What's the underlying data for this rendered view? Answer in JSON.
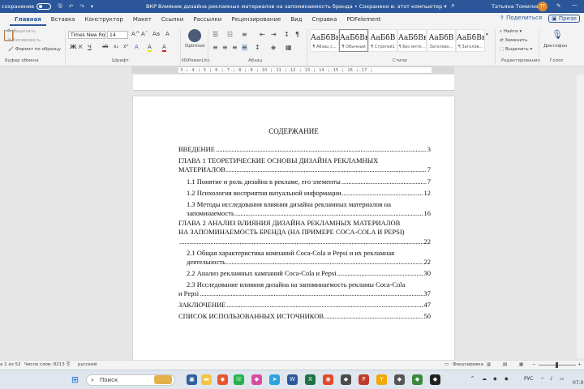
{
  "titlebar": {
    "autosave_label": "сохранение",
    "undo_icon": "undo-icon",
    "redo_icon": "redo-icon",
    "document_title": "ВКР Влияние дизайна рекламных материалов на запоминаемость бренда  •  Сохранено в: этот компьютер  ▾",
    "user_name": "Татьяна Томилова",
    "avatar_initials": "ТТ",
    "minimize_glyph": "—"
  },
  "tabs": [
    "Главная",
    "Вставка",
    "Конструктор",
    "Макет",
    "Ссылки",
    "Рассылки",
    "Рецензирование",
    "Вид",
    "Справка",
    "PDFelement"
  ],
  "active_tab": "Главная",
  "share_label": "Поделиться",
  "present_label": "Презе",
  "ribbon": {
    "clipboard": {
      "cut": "Вырезать",
      "copy": "Копировать",
      "format_painter": "Формат по образцу",
      "label": "Буфер обмена"
    },
    "font": {
      "name": "Times New Roi",
      "size": "14",
      "label": "Шрифт",
      "bold": "Ж",
      "italic": "К",
      "underline": "Ч",
      "strike": "ab",
      "sub": "x₂",
      "sup": "x²",
      "grow": "A^",
      "shrink": "Aˇ",
      "case": "Aa",
      "clear": "A",
      "highlight": "A",
      "color": "A"
    },
    "nxpower": {
      "button": "Optimize",
      "label": "NXPowerLite"
    },
    "paragraph": {
      "label": "Абзац"
    },
    "styles": {
      "label": "Стили",
      "tiles": [
        {
          "sample": "АаБбВв",
          "name": "¶ Абзац с..."
        },
        {
          "sample": "АаБбВв",
          "name": "¶ Обычный"
        },
        {
          "sample": "АаБбВ",
          "name": "¶ Строгий1"
        },
        {
          "sample": "АаБбВв",
          "name": "¶ Без инте..."
        },
        {
          "sample": "АаБбВ",
          "name": "Заголово..."
        },
        {
          "sample": "АаБбВв",
          "name": "¶ Заголов..."
        }
      ]
    },
    "editing": {
      "find": "Найти",
      "replace": "Заменить",
      "select": "Выделить",
      "label": "Редактирование"
    },
    "voice": {
      "dictate": "Диктофон",
      "label": "Голос"
    }
  },
  "ruler_text": "1 · ¦ · 1 · ⌂ · 1 · ¦ · 2 · ¦ · 3 · ¦ · 4 · ¦ · 5 · ¦ · 6 · ¦ · 7 · ¦ · 8 · ¦ · 9 · ¦ · 10 · ¦ · 11 · ¦ · 12 · ¦ · 13 · ¦ · 14 · ¦ · 15 · ¦ · 16 · ¦ · 17 · ¦",
  "document": {
    "heading": "СОДЕРЖАНИЕ",
    "toc": [
      {
        "text": "ВВЕДЕНИЕ",
        "page": "3"
      },
      {
        "text": "ГЛАВА 1 ТЕОРЕТИЧЕСКИЕ ОСНОВЫ ДИЗАЙНА РЕКЛАМНЫХ",
        "text2": "МАТЕРИАЛОВ",
        "page": "7"
      },
      {
        "text": "1.1 Понятие и роль дизайна в рекламе, его элементы",
        "page": "7"
      },
      {
        "text": "1.2 Психология восприятия визуальной информации",
        "page": "12"
      },
      {
        "text": "1.3 Методы исследования влияния дизайна рекламных материалов на",
        "text2": "запоминаемость",
        "page": "16"
      },
      {
        "text": "ГЛАВА 2 АНАЛИЗ ВЛИЯНИЯ ДИЗАЙНА РЕКЛАМНЫХ МАТЕРИАЛОВ",
        "text2": "НА ЗАПОМИНАЕМОСТЬ БРЕНДА (НА ПРИМЕРЕ COCA-COLA И PEPSI)",
        "page": "22"
      },
      {
        "text": "2.1 Общая характеристика компаний Coca-Cola и Pepsi и их рекламная",
        "text2": "деятельность",
        "page": "22"
      },
      {
        "text": "2.2 Анализ рекламных кампаний Coca-Cola и Pepsi",
        "page": "30"
      },
      {
        "text": "2.3 Исследование влияния дизайна на запоминаемость рекламы Coca-Cola",
        "text2": "и Pepsi",
        "page": "37"
      },
      {
        "text": "ЗАКЛЮЧЕНИЕ",
        "page": "47"
      },
      {
        "text": "СПИСОК ИСПОЛЬЗОВАННЫХ ИСТОЧНИКОВ",
        "page": "50"
      }
    ]
  },
  "status": {
    "page": "а 1 из 52",
    "words": "Число слов: 8213",
    "lang": "русский",
    "focus": "Фокусировка"
  },
  "taskbar": {
    "search": "Поиск",
    "lang": "РУС",
    "time": "07.0"
  }
}
